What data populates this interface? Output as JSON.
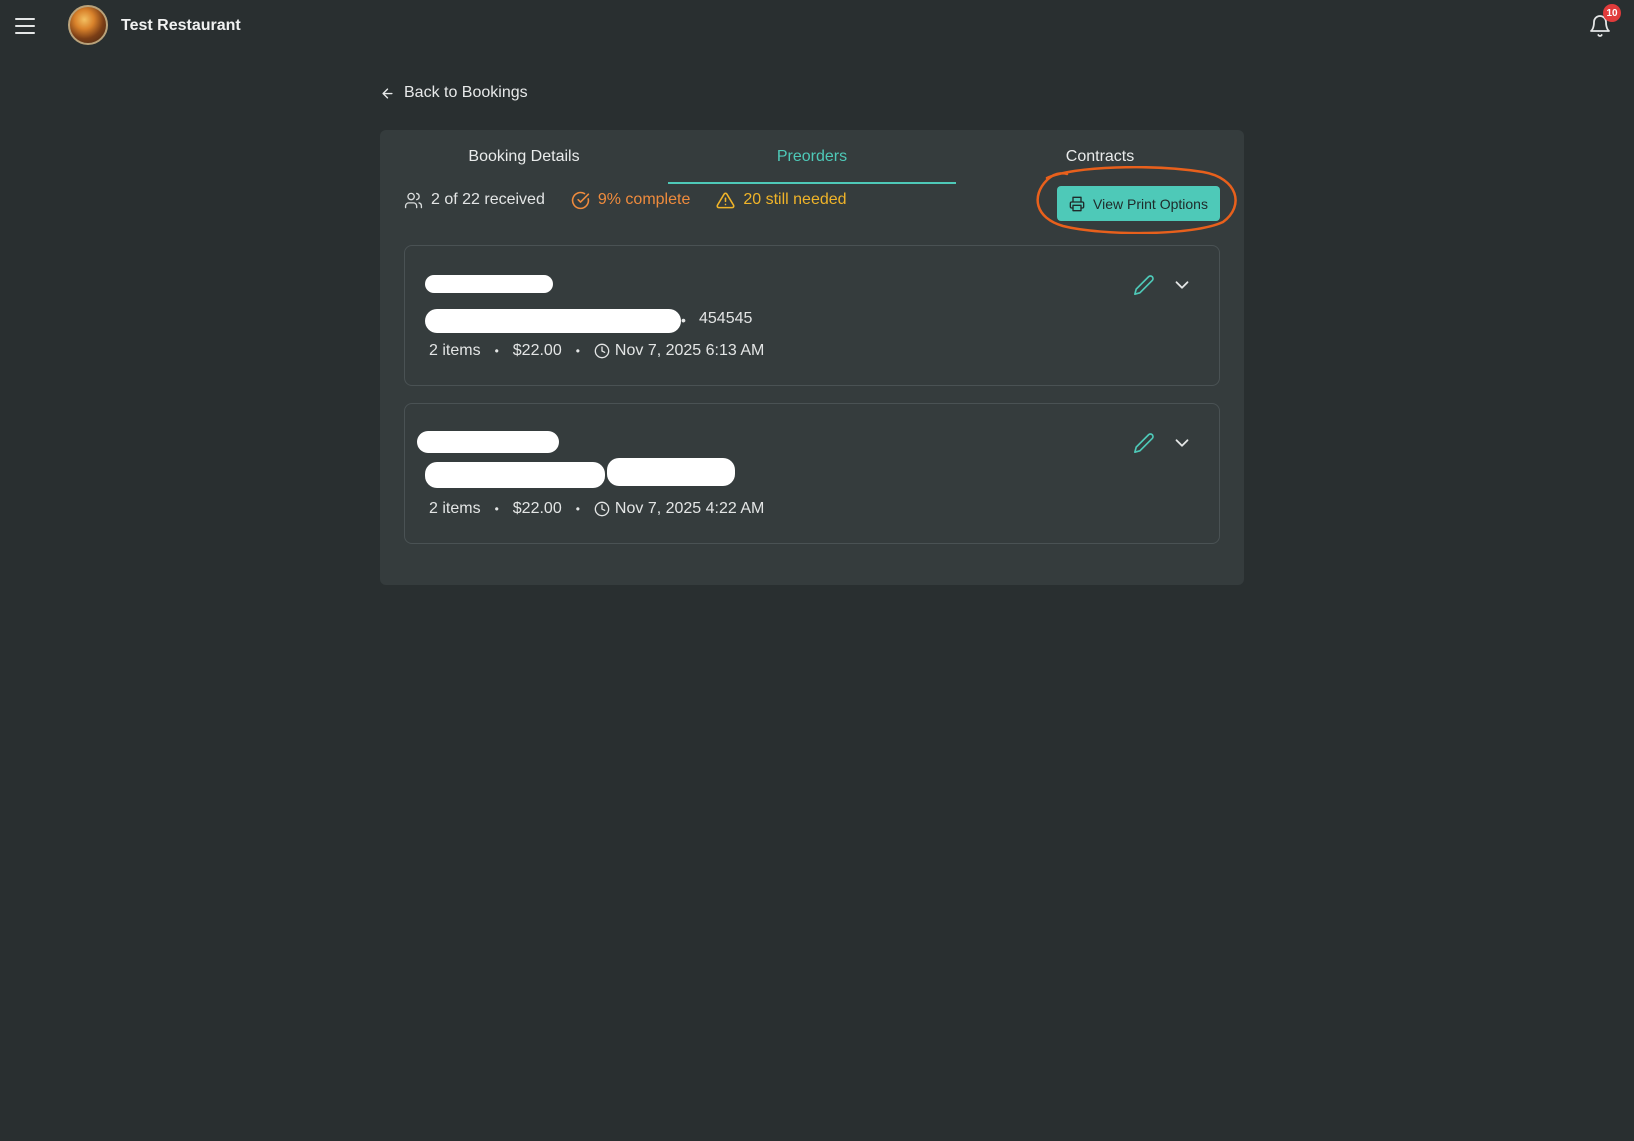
{
  "header": {
    "app_title": "Test Restaurant",
    "notification_count": "10"
  },
  "nav": {
    "back_label": "Back to Bookings"
  },
  "tabs": [
    {
      "label": "Booking Details",
      "active": false
    },
    {
      "label": "Preorders",
      "active": true
    },
    {
      "label": "Contracts",
      "active": false
    }
  ],
  "stats": {
    "received": "2 of 22 received",
    "complete": "9% complete",
    "needed": "20 still needed"
  },
  "actions": {
    "print_label": "View Print Options"
  },
  "colors": {
    "accent": "#4ec9b8",
    "warning_orange": "#ef8b3d",
    "warning_yellow": "#f0b429",
    "annotation": "#e8601c",
    "background": "#292f30",
    "panel": "#353c3d"
  },
  "preorders": [
    {
      "phone": "454545",
      "items": "2 items",
      "total": "$22.00",
      "time": "Nov 7, 2025 6:13 AM"
    },
    {
      "phone": "",
      "items": "2 items",
      "total": "$22.00",
      "time": "Nov 7, 2025 4:22 AM"
    }
  ]
}
